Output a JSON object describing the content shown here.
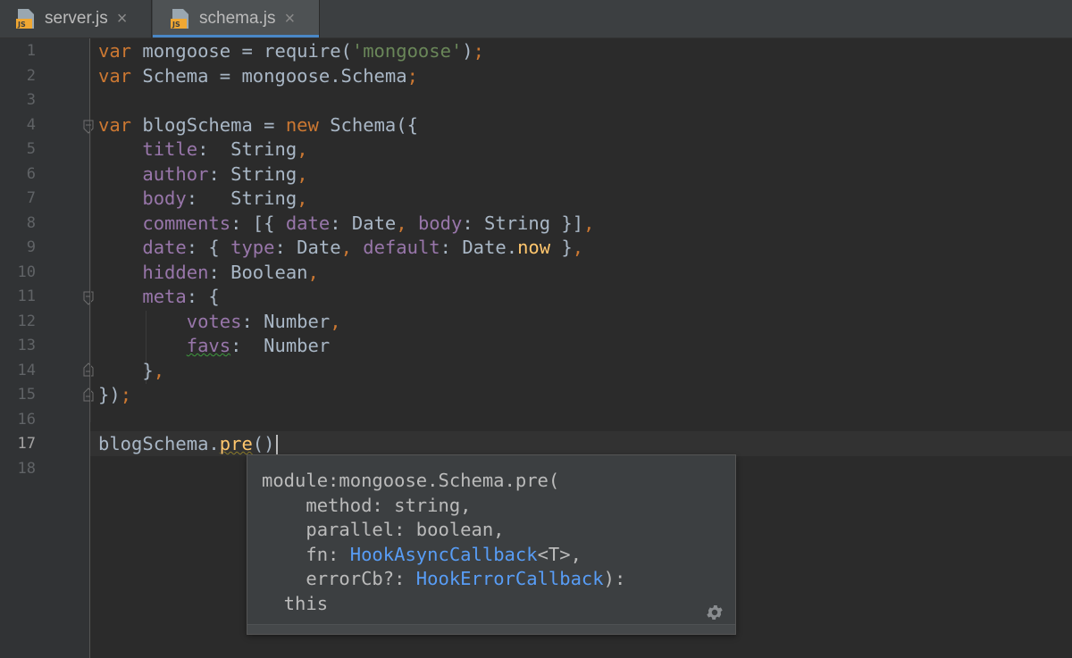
{
  "tabs": [
    {
      "label": "server.js",
      "icon": "js-file-icon",
      "active": false
    },
    {
      "label": "schema.js",
      "icon": "js-file-icon",
      "active": true
    }
  ],
  "file_icon_text": "JS",
  "close_glyph": "×",
  "line_numbers": [
    "1",
    "2",
    "3",
    "4",
    "5",
    "6",
    "7",
    "8",
    "9",
    "10",
    "11",
    "12",
    "13",
    "14",
    "15",
    "16",
    "17",
    "18"
  ],
  "current_line": 17,
  "code_lines": [
    "var mongoose = require('mongoose');",
    "var Schema = mongoose.Schema;",
    "",
    "var blogSchema = new Schema({",
    "    title:  String,",
    "    author: String,",
    "    body:   String,",
    "    comments: [{ date: Date, body: String }],",
    "    date: { type: Date, default: Date.now },",
    "    hidden: Boolean,",
    "    meta: {",
    "        votes: Number,",
    "        favs:  Number",
    "    },",
    "});",
    "",
    "blogSchema.pre()",
    ""
  ],
  "popup": {
    "lines": [
      "module:mongoose.Schema.pre(",
      "    method: string,",
      "    parallel: boolean,",
      "    fn: HookAsyncCallback<T>,",
      "    errorCb?: HookErrorCallback):",
      "  this"
    ],
    "links": [
      "HookAsyncCallback",
      "HookErrorCallback"
    ],
    "settings_icon": "gear-icon"
  },
  "colors": {
    "background": "#2b2b2b",
    "keyword": "#cc7832",
    "string": "#6a8759",
    "property": "#9876aa",
    "function": "#ffc66d",
    "default_text": "#a9b7c6",
    "link": "#589df6"
  }
}
